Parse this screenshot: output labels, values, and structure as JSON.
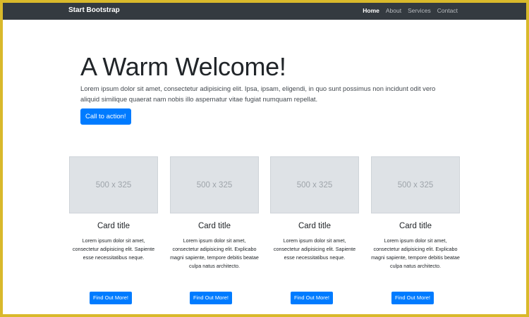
{
  "navbar": {
    "brand": "Start Bootstrap",
    "links": [
      {
        "label": "Home",
        "active": true
      },
      {
        "label": "About",
        "active": false
      },
      {
        "label": "Services",
        "active": false
      },
      {
        "label": "Contact",
        "active": false
      }
    ]
  },
  "hero": {
    "title": "A Warm Welcome!",
    "lead": "Lorem ipsum dolor sit amet, consectetur adipisicing elit. Ipsa, ipsam, eligendi, in quo sunt possimus non incidunt odit vero\naliquid similique quaerat nam nobis illo aspernatur vitae fugiat numquam repellat.",
    "cta_label": "Call to action!"
  },
  "cards": [
    {
      "image_label": "500 x 325",
      "title": "Card title",
      "text": "Lorem ipsum dolor sit amet, consectetur adipisicing elit. Sapiente esse necessitatibus neque.",
      "button": "Find Out More!"
    },
    {
      "image_label": "500 x 325",
      "title": "Card title",
      "text": "Lorem ipsum dolor sit amet, consectetur adipisicing elit. Explicabo magni sapiente, tempore debitis beatae culpa natus architecto.",
      "button": "Find Out More!"
    },
    {
      "image_label": "500 x 325",
      "title": "Card title",
      "text": "Lorem ipsum dolor sit amet, consectetur adipisicing elit. Sapiente esse necessitatibus neque.",
      "button": "Find Out More!"
    },
    {
      "image_label": "500 x 325",
      "title": "Card title",
      "text": "Lorem ipsum dolor sit amet, consectetur adipisicing elit. Explicabo magni sapiente, tempore debitis beatae culpa natus architecto.",
      "button": "Find Out More!"
    }
  ],
  "colors": {
    "frame": "#d9b92b",
    "navbar_bg": "#343a40",
    "primary": "#007bff",
    "placeholder_bg": "#dee2e6"
  }
}
